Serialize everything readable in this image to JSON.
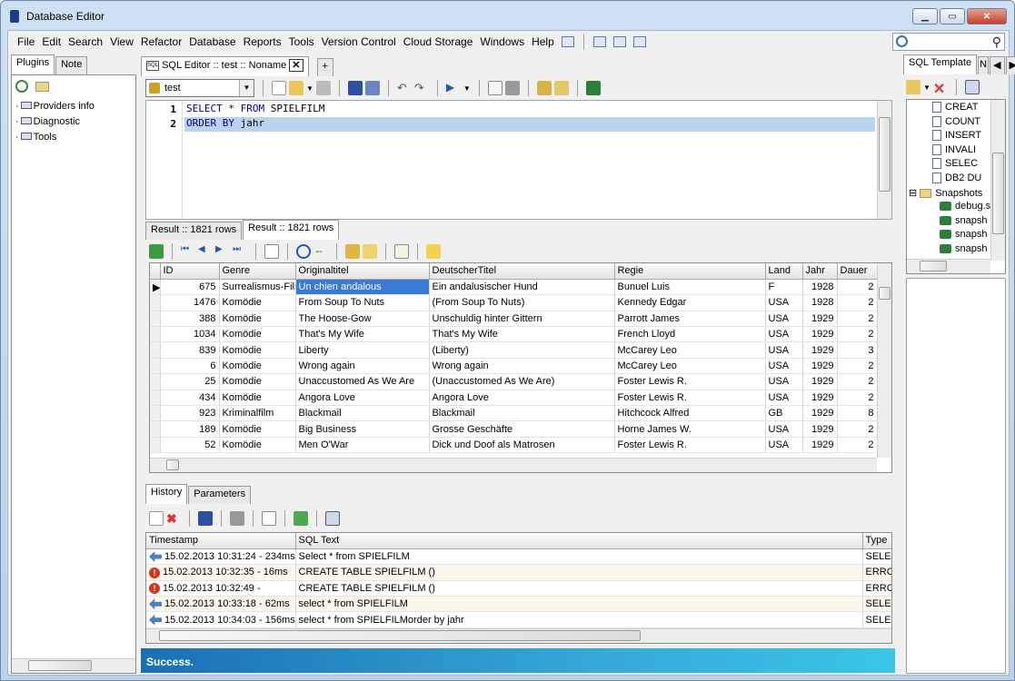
{
  "window": {
    "title": "Database Editor"
  },
  "menu": [
    "File",
    "Edit",
    "Search",
    "View",
    "Refactor",
    "Database",
    "Reports",
    "Tools",
    "Version Control",
    "Cloud Storage",
    "Windows",
    "Help"
  ],
  "left_panel": {
    "tabs": [
      "Plugins",
      "Note"
    ],
    "items": [
      "Providers info",
      "Diagnostic",
      "Tools"
    ]
  },
  "editor_tab": {
    "label": "SQL Editor :: test :: Noname",
    "add": "+"
  },
  "connection": {
    "value": "test"
  },
  "sql": {
    "line1_num": "1",
    "line1_kw1": "SELECT",
    "line1_rest1": " * ",
    "line1_kw2": "FROM",
    "line1_rest2": " SPIELFILM",
    "line2_num": "2",
    "line2_kw": "ORDER BY",
    "line2_rest": " jahr"
  },
  "result_tabs": [
    "Result :: 1821 rows",
    "Result :: 1821 rows"
  ],
  "grid": {
    "columns": [
      "ID",
      "Genre",
      "Originaltitel",
      "DeutscherTitel",
      "Regie",
      "Land",
      "Jahr",
      "Dauer"
    ],
    "rows": [
      [
        "675",
        "Surrealismus-Film",
        "Un chien andalous",
        "Ein andalusischer Hund",
        "Bunuel Luis",
        "F",
        "1928",
        "2"
      ],
      [
        "1476",
        "Komödie",
        "From Soup To Nuts",
        "(From Soup To Nuts)",
        "Kennedy Edgar",
        "USA",
        "1928",
        "2"
      ],
      [
        "388",
        "Komödie",
        "The Hoose-Gow",
        "Unschuldig hinter Gittern",
        "Parrott James",
        "USA",
        "1929",
        "2"
      ],
      [
        "1034",
        "Komödie",
        "That's My Wife",
        "That's My Wife",
        "French Lloyd",
        "USA",
        "1929",
        "2"
      ],
      [
        "839",
        "Komödie",
        "Liberty",
        "(Liberty)",
        "McCarey Leo",
        "USA",
        "1929",
        "3"
      ],
      [
        "6",
        "Komödie",
        "Wrong again",
        "Wrong again",
        "McCarey Leo",
        "USA",
        "1929",
        "2"
      ],
      [
        "25",
        "Komödie",
        "Unaccustomed As We Are",
        "(Unaccustomed As We Are)",
        "Foster Lewis R.",
        "USA",
        "1929",
        "2"
      ],
      [
        "434",
        "Komödie",
        "Angora Love",
        "Angora Love",
        "Foster Lewis R.",
        "USA",
        "1929",
        "2"
      ],
      [
        "923",
        "Kriminalfilm",
        "Blackmail",
        "Blackmail",
        "Hitchcock Alfred",
        "GB",
        "1929",
        "8"
      ],
      [
        "189",
        "Komödie",
        "Big Business",
        "Grosse Geschäfte",
        "Horne James W.",
        "USA",
        "1929",
        "2"
      ],
      [
        "52",
        "Komödie",
        "Men O'War",
        "Dick und Doof als Matrosen",
        "Foster Lewis R.",
        "USA",
        "1929",
        "2"
      ]
    ]
  },
  "history_tabs": [
    "History",
    "Parameters"
  ],
  "history": {
    "columns": [
      "Timestamp",
      "SQL Text",
      "Type"
    ],
    "rows": [
      {
        "icon": "arrow-icon",
        "ts": "15.02.2013 10:31:24 - 234ms",
        "sql": "Select * from SPIELFILM",
        "type": "SELE"
      },
      {
        "icon": "error-icon",
        "ts": "15.02.2013 10:32:35 - 16ms",
        "sql": "CREATE TABLE SPIELFILM ()",
        "type": "ERRC"
      },
      {
        "icon": "error-icon",
        "ts": "15.02.2013 10:32:49 -",
        "sql": "CREATE TABLE SPIELFILM ()",
        "type": "ERRC"
      },
      {
        "icon": "arrow-icon",
        "ts": "15.02.2013 10:33:18 - 62ms",
        "sql": "select * from SPIELFILM",
        "type": "SELE"
      },
      {
        "icon": "arrow-icon",
        "ts": "15.02.2013 10:34:03 - 156ms",
        "sql": "select * from SPIELFILMorder by jahr",
        "type": "SELE"
      }
    ]
  },
  "status": "Success.",
  "right_panel": {
    "tab": "SQL Template",
    "tab2": "N",
    "templates": [
      "CREAT",
      "COUNT",
      "INSERT",
      "INVALI",
      "SELEC",
      "DB2 DU"
    ],
    "snapshots_label": "Snapshots",
    "snapshots": [
      "debug.s",
      "snapsh",
      "snapsh",
      "snapsh"
    ]
  }
}
